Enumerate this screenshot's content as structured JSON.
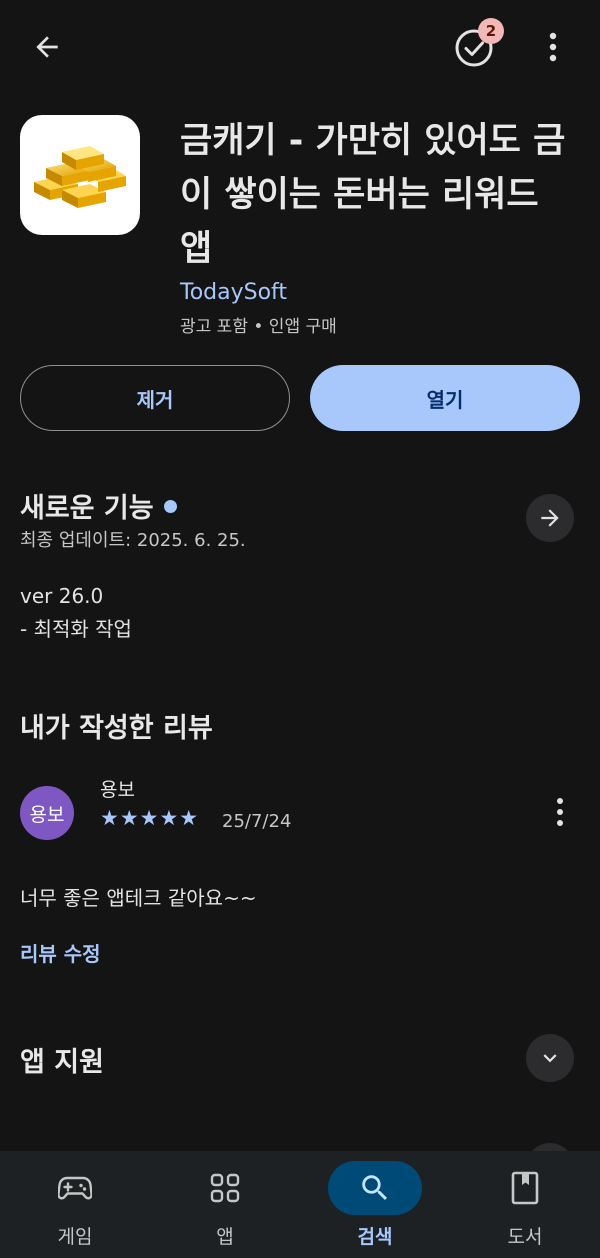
{
  "header": {
    "back_icon": "arrow-back-icon",
    "tasks_icon": "check-circle-icon",
    "tasks_badge": "2",
    "more_icon": "more-vert-icon"
  },
  "app": {
    "icon": "gold-bars-icon",
    "title": "금캐기 - 가만히 있어도 금이 쌓이는 돈버는 리워드 앱",
    "developer": "TodaySoft",
    "meta": "광고 포함 • 인앱 구매"
  },
  "actions": {
    "remove_label": "제거",
    "open_label": "열기"
  },
  "whats_new": {
    "title": "새로운 기능",
    "last_updated": "최종 업데이트: 2025. 6. 25.",
    "notes_line1": "ver 26.0",
    "notes_line2": "- 최적화 작업"
  },
  "my_review": {
    "title": "내가 작성한 리뷰",
    "avatar_text": "용보",
    "reviewer_name": "용보",
    "rating": 5,
    "stars": "★★★★★",
    "date": "25/7/24",
    "text": "너무 좋은 앱테크 같아요~~",
    "edit_label": "리뷰 수정"
  },
  "app_support": {
    "title": "앱 지원"
  },
  "bottom_nav": {
    "items": [
      {
        "label": "게임",
        "icon": "gamepad-icon",
        "active": false
      },
      {
        "label": "앱",
        "icon": "apps-grid-icon",
        "active": false
      },
      {
        "label": "검색",
        "icon": "search-icon",
        "active": true
      },
      {
        "label": "도서",
        "icon": "book-icon",
        "active": false
      }
    ]
  },
  "colors": {
    "background": "#141414",
    "accent": "#a8c7fa",
    "nav_active": "#004a77",
    "avatar": "#7e57c2",
    "badge": "#f2b8b5"
  }
}
